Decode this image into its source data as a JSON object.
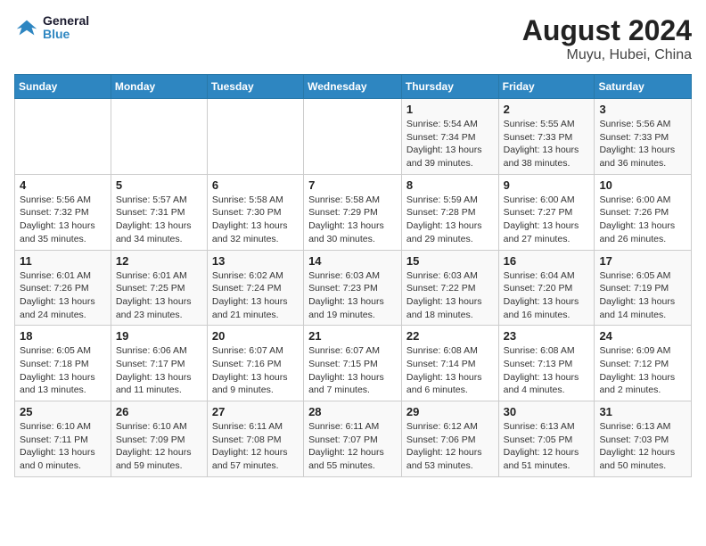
{
  "header": {
    "logo_line1": "General",
    "logo_line2": "Blue",
    "title": "August 2024",
    "subtitle": "Muyu, Hubei, China"
  },
  "weekdays": [
    "Sunday",
    "Monday",
    "Tuesday",
    "Wednesday",
    "Thursday",
    "Friday",
    "Saturday"
  ],
  "weeks": [
    [
      {
        "day": "",
        "info": ""
      },
      {
        "day": "",
        "info": ""
      },
      {
        "day": "",
        "info": ""
      },
      {
        "day": "",
        "info": ""
      },
      {
        "day": "1",
        "info": "Sunrise: 5:54 AM\nSunset: 7:34 PM\nDaylight: 13 hours\nand 39 minutes."
      },
      {
        "day": "2",
        "info": "Sunrise: 5:55 AM\nSunset: 7:33 PM\nDaylight: 13 hours\nand 38 minutes."
      },
      {
        "day": "3",
        "info": "Sunrise: 5:56 AM\nSunset: 7:33 PM\nDaylight: 13 hours\nand 36 minutes."
      }
    ],
    [
      {
        "day": "4",
        "info": "Sunrise: 5:56 AM\nSunset: 7:32 PM\nDaylight: 13 hours\nand 35 minutes."
      },
      {
        "day": "5",
        "info": "Sunrise: 5:57 AM\nSunset: 7:31 PM\nDaylight: 13 hours\nand 34 minutes."
      },
      {
        "day": "6",
        "info": "Sunrise: 5:58 AM\nSunset: 7:30 PM\nDaylight: 13 hours\nand 32 minutes."
      },
      {
        "day": "7",
        "info": "Sunrise: 5:58 AM\nSunset: 7:29 PM\nDaylight: 13 hours\nand 30 minutes."
      },
      {
        "day": "8",
        "info": "Sunrise: 5:59 AM\nSunset: 7:28 PM\nDaylight: 13 hours\nand 29 minutes."
      },
      {
        "day": "9",
        "info": "Sunrise: 6:00 AM\nSunset: 7:27 PM\nDaylight: 13 hours\nand 27 minutes."
      },
      {
        "day": "10",
        "info": "Sunrise: 6:00 AM\nSunset: 7:26 PM\nDaylight: 13 hours\nand 26 minutes."
      }
    ],
    [
      {
        "day": "11",
        "info": "Sunrise: 6:01 AM\nSunset: 7:26 PM\nDaylight: 13 hours\nand 24 minutes."
      },
      {
        "day": "12",
        "info": "Sunrise: 6:01 AM\nSunset: 7:25 PM\nDaylight: 13 hours\nand 23 minutes."
      },
      {
        "day": "13",
        "info": "Sunrise: 6:02 AM\nSunset: 7:24 PM\nDaylight: 13 hours\nand 21 minutes."
      },
      {
        "day": "14",
        "info": "Sunrise: 6:03 AM\nSunset: 7:23 PM\nDaylight: 13 hours\nand 19 minutes."
      },
      {
        "day": "15",
        "info": "Sunrise: 6:03 AM\nSunset: 7:22 PM\nDaylight: 13 hours\nand 18 minutes."
      },
      {
        "day": "16",
        "info": "Sunrise: 6:04 AM\nSunset: 7:20 PM\nDaylight: 13 hours\nand 16 minutes."
      },
      {
        "day": "17",
        "info": "Sunrise: 6:05 AM\nSunset: 7:19 PM\nDaylight: 13 hours\nand 14 minutes."
      }
    ],
    [
      {
        "day": "18",
        "info": "Sunrise: 6:05 AM\nSunset: 7:18 PM\nDaylight: 13 hours\nand 13 minutes."
      },
      {
        "day": "19",
        "info": "Sunrise: 6:06 AM\nSunset: 7:17 PM\nDaylight: 13 hours\nand 11 minutes."
      },
      {
        "day": "20",
        "info": "Sunrise: 6:07 AM\nSunset: 7:16 PM\nDaylight: 13 hours\nand 9 minutes."
      },
      {
        "day": "21",
        "info": "Sunrise: 6:07 AM\nSunset: 7:15 PM\nDaylight: 13 hours\nand 7 minutes."
      },
      {
        "day": "22",
        "info": "Sunrise: 6:08 AM\nSunset: 7:14 PM\nDaylight: 13 hours\nand 6 minutes."
      },
      {
        "day": "23",
        "info": "Sunrise: 6:08 AM\nSunset: 7:13 PM\nDaylight: 13 hours\nand 4 minutes."
      },
      {
        "day": "24",
        "info": "Sunrise: 6:09 AM\nSunset: 7:12 PM\nDaylight: 13 hours\nand 2 minutes."
      }
    ],
    [
      {
        "day": "25",
        "info": "Sunrise: 6:10 AM\nSunset: 7:11 PM\nDaylight: 13 hours\nand 0 minutes."
      },
      {
        "day": "26",
        "info": "Sunrise: 6:10 AM\nSunset: 7:09 PM\nDaylight: 12 hours\nand 59 minutes."
      },
      {
        "day": "27",
        "info": "Sunrise: 6:11 AM\nSunset: 7:08 PM\nDaylight: 12 hours\nand 57 minutes."
      },
      {
        "day": "28",
        "info": "Sunrise: 6:11 AM\nSunset: 7:07 PM\nDaylight: 12 hours\nand 55 minutes."
      },
      {
        "day": "29",
        "info": "Sunrise: 6:12 AM\nSunset: 7:06 PM\nDaylight: 12 hours\nand 53 minutes."
      },
      {
        "day": "30",
        "info": "Sunrise: 6:13 AM\nSunset: 7:05 PM\nDaylight: 12 hours\nand 51 minutes."
      },
      {
        "day": "31",
        "info": "Sunrise: 6:13 AM\nSunset: 7:03 PM\nDaylight: 12 hours\nand 50 minutes."
      }
    ]
  ]
}
